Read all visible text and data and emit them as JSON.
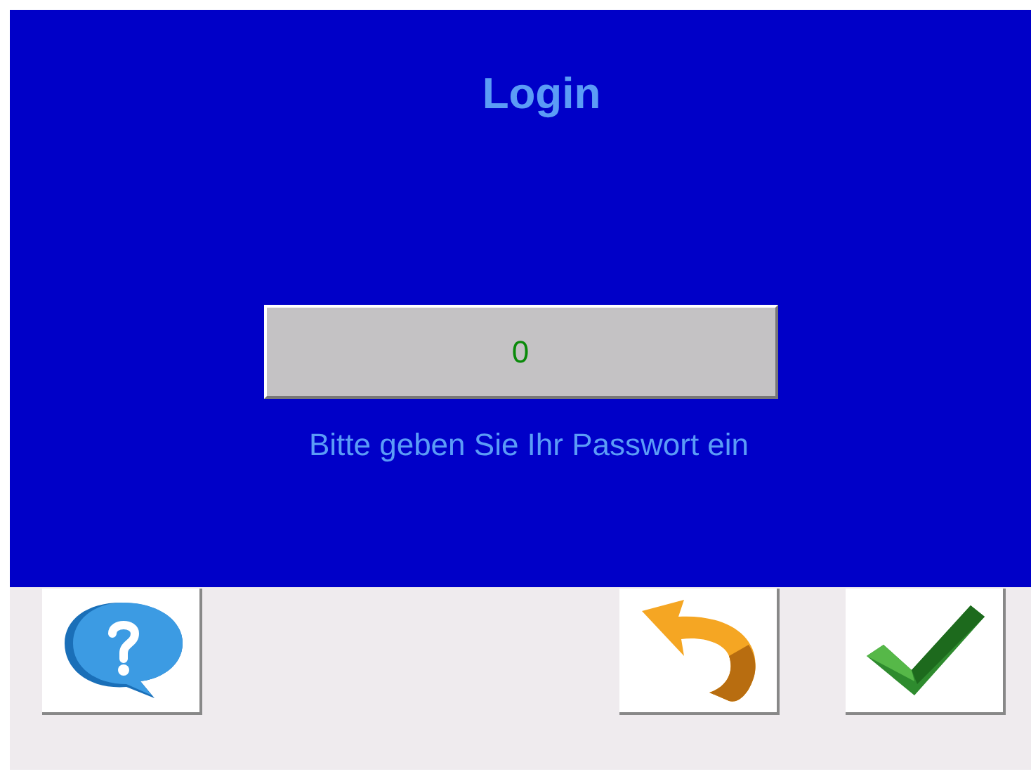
{
  "title": "Login",
  "password_field": {
    "value": "0"
  },
  "hint": "Bitte geben Sie Ihr Passwort ein",
  "buttons": [
    {
      "kind": "help"
    },
    {
      "kind": "back"
    },
    {
      "kind": "confirm"
    }
  ]
}
